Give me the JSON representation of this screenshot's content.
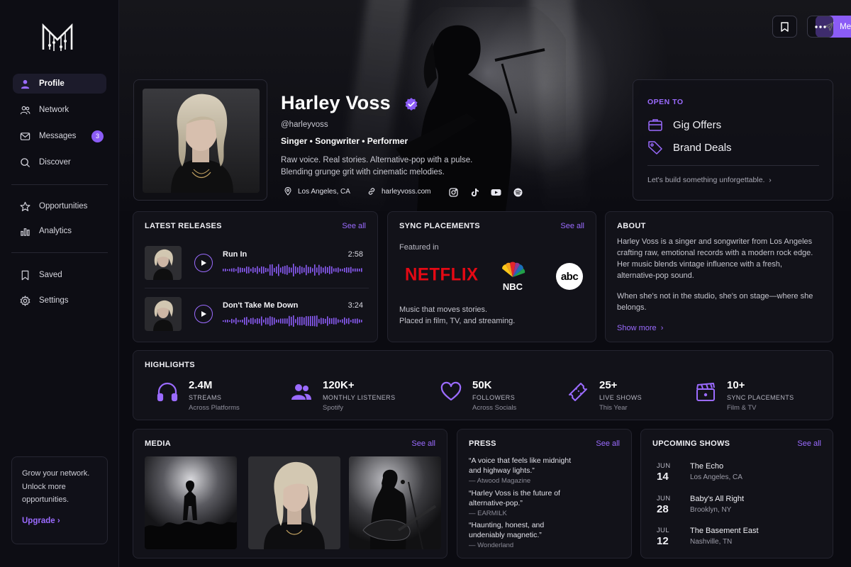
{
  "sidebar": {
    "items": [
      {
        "label": "Profile"
      },
      {
        "label": "Network"
      },
      {
        "label": "Messages",
        "badge": "3"
      },
      {
        "label": "Discover"
      },
      {
        "label": "Opportunities"
      },
      {
        "label": "Analytics"
      },
      {
        "label": "Saved"
      },
      {
        "label": "Settings"
      }
    ],
    "promo": {
      "text": "Grow your network. Unlock more opportunities.",
      "cta": "Upgrade"
    }
  },
  "header": {
    "message_label": "Message"
  },
  "profile": {
    "name": "Harley Voss",
    "handle": "@harleyvoss",
    "roles": "Singer  •  Songwriter  •  Performer",
    "bio_line1": "Raw voice. Real stories. Alternative-pop with a pulse.",
    "bio_line2": "Blending grunge grit with cinematic melodies.",
    "location": "Los Angeles, CA",
    "website": "harleyvoss.com"
  },
  "open_to": {
    "title": "OPEN TO",
    "items": [
      "Gig Offers",
      "Brand Deals"
    ],
    "cta": "Let's build something unforgettable."
  },
  "releases": {
    "title": "LATEST RELEASES",
    "see_all": "See all",
    "tracks": [
      {
        "title": "Run In",
        "duration": "2:58"
      },
      {
        "title": "Don't Take Me Down",
        "duration": "3:24"
      }
    ]
  },
  "sync": {
    "title": "SYNC PLACEMENTS",
    "see_all": "See all",
    "featured": "Featured in",
    "logos": [
      "NETFLIX",
      "NBC",
      "abc"
    ],
    "desc1": "Music that moves stories.",
    "desc2": "Placed in film, TV, and streaming."
  },
  "about": {
    "title": "ABOUT",
    "p1": "Harley Voss is a singer and songwriter from Los Angeles crafting raw, emotional records with a modern rock edge. Her music blends vintage influence with a fresh, alternative-pop sound.",
    "p2": "When she's not in the studio, she's on stage—where she belongs.",
    "show_more": "Show more"
  },
  "highlights": {
    "title": "HIGHLIGHTS",
    "stats": [
      {
        "value": "2.4M",
        "label": "STREAMS",
        "sub": "Across Platforms",
        "icon": "headphones-icon"
      },
      {
        "value": "120K+",
        "label": "MONTHLY LISTENERS",
        "sub": "Spotify",
        "icon": "users-icon"
      },
      {
        "value": "50K",
        "label": "FOLLOWERS",
        "sub": "Across Socials",
        "icon": "heart-icon"
      },
      {
        "value": "25+",
        "label": "LIVE SHOWS",
        "sub": "This Year",
        "icon": "ticket-icon"
      },
      {
        "value": "10+",
        "label": "SYNC PLACEMENTS",
        "sub": "Film & TV",
        "icon": "clapper-icon"
      }
    ]
  },
  "media": {
    "title": "MEDIA",
    "see_all": "See all"
  },
  "press": {
    "title": "PRESS",
    "see_all": "See all",
    "quotes": [
      {
        "q1": "“A voice that feels like midnight",
        "q2": "and highway lights.”",
        "src": "— Atwood Magazine"
      },
      {
        "q1": "“Harley Voss is the future of",
        "q2": "alternative-pop.”",
        "src": "— EARMILK"
      },
      {
        "q1": "“Haunting, honest, and",
        "q2": "undeniably magnetic.”",
        "src": "— Wonderland"
      }
    ]
  },
  "shows": {
    "title": "UPCOMING SHOWS",
    "see_all": "See all",
    "items": [
      {
        "month": "JUN",
        "day": "14",
        "venue": "The Echo",
        "location": "Los Angeles, CA"
      },
      {
        "month": "JUN",
        "day": "28",
        "venue": "Baby's All Right",
        "location": "Brooklyn, NY"
      },
      {
        "month": "JUL",
        "day": "12",
        "venue": "The Basement East",
        "location": "Nashville, TN"
      }
    ]
  },
  "colors": {
    "accent": "#8b5cf6",
    "background": "#0b0b11",
    "card": "#121219"
  }
}
